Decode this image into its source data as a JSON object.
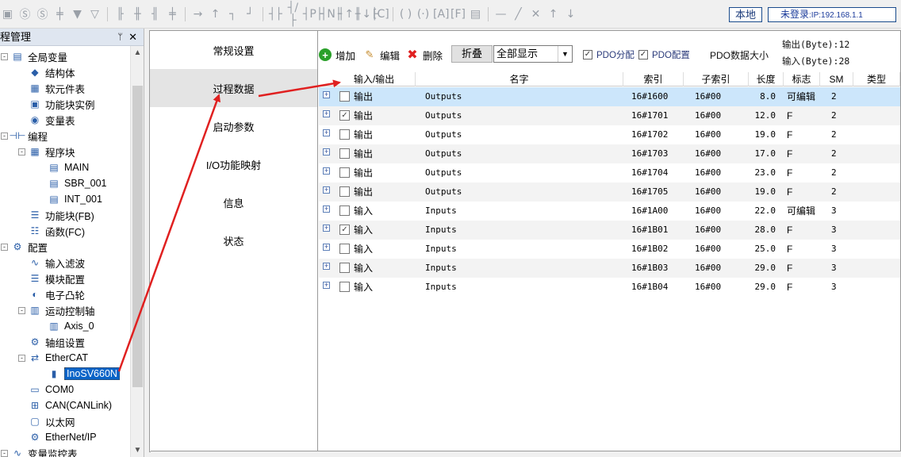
{
  "topbar": {
    "local_label": "本地",
    "login_label": "未登录",
    "login_ip": ":IP:192.168.1.1"
  },
  "left_panel": {
    "title": "程管理",
    "items": [
      {
        "label": "全局变量",
        "icon": "global-var-icon",
        "level": 1,
        "exp": "-"
      },
      {
        "label": "结构体",
        "icon": "struct-icon",
        "level": 2
      },
      {
        "label": "软元件表",
        "icon": "device-table-icon",
        "level": 2
      },
      {
        "label": "功能块实例",
        "icon": "fb-instance-icon",
        "level": 2
      },
      {
        "label": "变量表",
        "icon": "var-table-icon",
        "level": 2
      },
      {
        "label": "编程",
        "icon": "program-icon",
        "level": 1,
        "exp": "-"
      },
      {
        "label": "程序块",
        "icon": "program-block-icon",
        "level": 2,
        "exp": "-"
      },
      {
        "label": "MAIN",
        "icon": "main-icon",
        "level": 3
      },
      {
        "label": "SBR_001",
        "icon": "sbr-icon",
        "level": 3
      },
      {
        "label": "INT_001",
        "icon": "int-icon",
        "level": 3
      },
      {
        "label": "功能块(FB)",
        "icon": "fb-icon",
        "level": 2
      },
      {
        "label": "函数(FC)",
        "icon": "fc-icon",
        "level": 2
      },
      {
        "label": "配置",
        "icon": "config-icon",
        "level": 1,
        "exp": "-"
      },
      {
        "label": "输入滤波",
        "icon": "filter-icon",
        "level": 2
      },
      {
        "label": "模块配置",
        "icon": "module-config-icon",
        "level": 2
      },
      {
        "label": "电子凸轮",
        "icon": "cam-icon",
        "level": 2
      },
      {
        "label": "运动控制轴",
        "icon": "motion-axis-icon",
        "level": 2,
        "exp": "-"
      },
      {
        "label": "Axis_0",
        "icon": "axis-icon",
        "level": 3
      },
      {
        "label": "轴组设置",
        "icon": "axis-group-icon",
        "level": 2
      },
      {
        "label": "EtherCAT",
        "icon": "ethercat-icon",
        "level": 2,
        "exp": "-"
      },
      {
        "label": "InoSV660N",
        "icon": "servo-icon",
        "level": 3,
        "selected": true
      },
      {
        "label": "COM0",
        "icon": "com-icon",
        "level": 2
      },
      {
        "label": "CAN(CANLink)",
        "icon": "can-icon",
        "level": 2
      },
      {
        "label": "以太网",
        "icon": "ethernet-icon",
        "level": 2
      },
      {
        "label": "EtherNet/IP",
        "icon": "ethernetip-icon",
        "level": 2
      },
      {
        "label": "变量监控表",
        "icon": "monitor-icon",
        "level": 1,
        "exp": "-"
      }
    ]
  },
  "side_tabs": [
    "常规设置",
    "过程数据",
    "启动参数",
    "I/O功能映射",
    "信息",
    "状态"
  ],
  "active_side_tab": 1,
  "toolbar": {
    "add_label": "增加",
    "edit_label": "编辑",
    "delete_label": "删除",
    "fold_label": "折叠",
    "display_select": "全部显示",
    "pdo_assign_label": "PDO分配",
    "pdo_config_label": "PDO配置",
    "pdo_size_label": "PDO数据大小",
    "output_bytes": "输出(Byte):12",
    "input_bytes": "输入(Byte):28"
  },
  "table": {
    "headers": [
      "输入/输出",
      "名字",
      "索引",
      "子索引",
      "长度",
      "标志",
      "SM",
      "类型"
    ],
    "rows": [
      {
        "io": "输出",
        "checked": false,
        "name": "Outputs",
        "index": "16#1600",
        "sub": "16#00",
        "len": "8.0",
        "flag": "可编辑",
        "sm": "2"
      },
      {
        "io": "输出",
        "checked": true,
        "name": "Outputs",
        "index": "16#1701",
        "sub": "16#00",
        "len": "12.0",
        "flag": "F",
        "sm": "2"
      },
      {
        "io": "输出",
        "checked": false,
        "name": "Outputs",
        "index": "16#1702",
        "sub": "16#00",
        "len": "19.0",
        "flag": "F",
        "sm": "2"
      },
      {
        "io": "输出",
        "checked": false,
        "name": "Outputs",
        "index": "16#1703",
        "sub": "16#00",
        "len": "17.0",
        "flag": "F",
        "sm": "2"
      },
      {
        "io": "输出",
        "checked": false,
        "name": "Outputs",
        "index": "16#1704",
        "sub": "16#00",
        "len": "23.0",
        "flag": "F",
        "sm": "2"
      },
      {
        "io": "输出",
        "checked": false,
        "name": "Outputs",
        "index": "16#1705",
        "sub": "16#00",
        "len": "19.0",
        "flag": "F",
        "sm": "2"
      },
      {
        "io": "输入",
        "checked": false,
        "name": "Inputs",
        "index": "16#1A00",
        "sub": "16#00",
        "len": "22.0",
        "flag": "可编辑",
        "sm": "3"
      },
      {
        "io": "输入",
        "checked": true,
        "name": "Inputs",
        "index": "16#1B01",
        "sub": "16#00",
        "len": "28.0",
        "flag": "F",
        "sm": "3"
      },
      {
        "io": "输入",
        "checked": false,
        "name": "Inputs",
        "index": "16#1B02",
        "sub": "16#00",
        "len": "25.0",
        "flag": "F",
        "sm": "3"
      },
      {
        "io": "输入",
        "checked": false,
        "name": "Inputs",
        "index": "16#1B03",
        "sub": "16#00",
        "len": "29.0",
        "flag": "F",
        "sm": "3"
      },
      {
        "io": "输入",
        "checked": false,
        "name": "Inputs",
        "index": "16#1B04",
        "sub": "16#00",
        "len": "29.0",
        "flag": "F",
        "sm": "3"
      }
    ]
  },
  "colors": {
    "annotation_arrow": "#e02020",
    "selection": "#0a64c8",
    "row_selected": "#cce6fb"
  }
}
